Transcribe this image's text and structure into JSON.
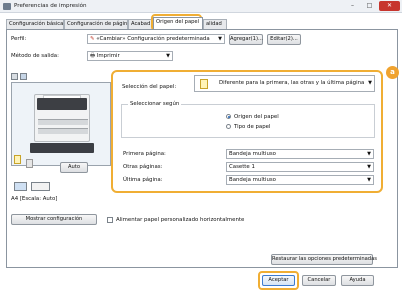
{
  "window": {
    "title": "Preferencias de impresión",
    "close": "✕",
    "minimize": "–",
    "maximize": "□"
  },
  "tabs": [
    {
      "label": "Configuración básica"
    },
    {
      "label": "Configuración de página"
    },
    {
      "label": "Acabad"
    },
    {
      "label": "Origen del papel"
    },
    {
      "label": "alidad"
    }
  ],
  "profile": {
    "label": "Perfil:",
    "value": "«Cambiar» Configuración predeterminada",
    "add_button": "Agregar(1)...",
    "edit_button": "Editar(2)..."
  },
  "output_method": {
    "label": "Método de salida:",
    "value": "Imprimir"
  },
  "preview": {
    "auto_button": "Auto",
    "paper_caption": "A4 [Escala: Auto]"
  },
  "paper_selection": {
    "label": "Selección del papel:",
    "value": "Diferente para la primera, las otras y la última página"
  },
  "select_by": {
    "title": "Seleccionar según",
    "options": [
      {
        "label": "Origen del papel",
        "selected": true
      },
      {
        "label": "Tipo de papel",
        "selected": false
      }
    ]
  },
  "sources": [
    {
      "label": "Primera página:",
      "value": "Bandeja multiuso"
    },
    {
      "label": "Otras páginas:",
      "value": "Casette 1"
    },
    {
      "label": "Última página:",
      "value": "Bandeja multiuso"
    }
  ],
  "show_config_button": "Mostrar configuración",
  "custom_paper_checkbox": "Alimentar papel personalizado horizontalmente",
  "restore_button": "Restaurar las opciones predeterminadas",
  "footer": {
    "accept": "Aceptar",
    "cancel": "Cancelar",
    "help": "Ayuda"
  },
  "badge": "a",
  "colors": {
    "accent": "#f0ae34",
    "close": "#c7352d"
  }
}
